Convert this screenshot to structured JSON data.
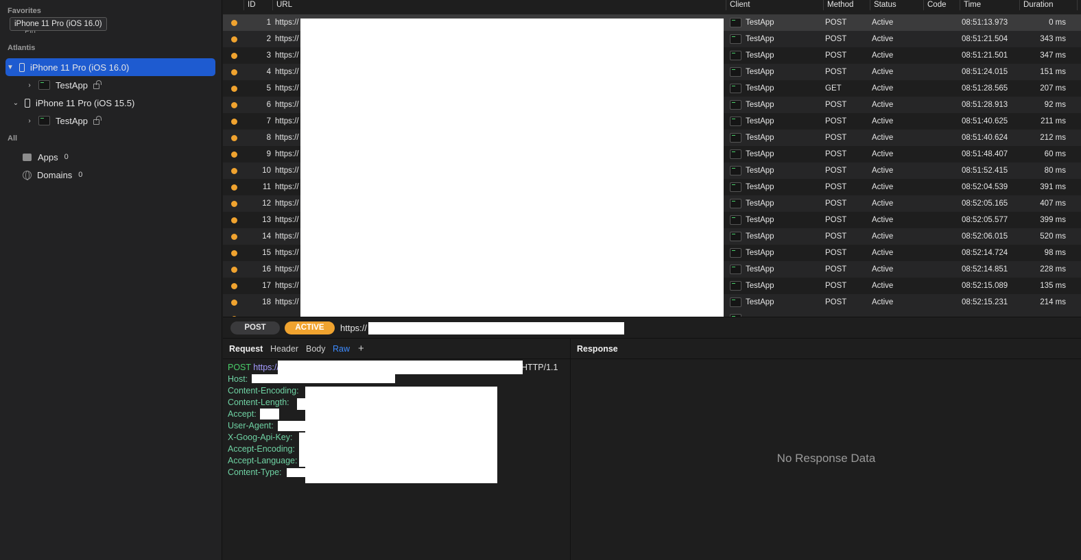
{
  "sidebar": {
    "favorites_title": "Favorites",
    "tooltip": "iPhone 11 Pro (iOS 16.0)",
    "pin_label": "Pin",
    "atlantis_title": "Atlantis",
    "devices": [
      {
        "label": "iPhone 11 Pro (iOS 16.0)",
        "app": "TestApp"
      },
      {
        "label": "iPhone 11 Pro (iOS 15.5)",
        "app": "TestApp"
      }
    ],
    "all_title": "All",
    "apps_label": "Apps",
    "apps_count": "0",
    "domains_label": "Domains",
    "domains_count": "0"
  },
  "table": {
    "headers": {
      "id": "ID",
      "url": "URL",
      "client": "Client",
      "method": "Method",
      "status": "Status",
      "code": "Code",
      "time": "Time",
      "duration": "Duration"
    },
    "rows": [
      {
        "id": "1",
        "url": "https://",
        "client": "TestApp",
        "method": "POST",
        "status": "Active",
        "time": "08:51:13.973",
        "duration": "0 ms"
      },
      {
        "id": "2",
        "url": "https://",
        "client": "TestApp",
        "method": "POST",
        "status": "Active",
        "time": "08:51:21.504",
        "duration": "343 ms"
      },
      {
        "id": "3",
        "url": "https://",
        "client": "TestApp",
        "method": "POST",
        "status": "Active",
        "time": "08:51:21.501",
        "duration": "347 ms"
      },
      {
        "id": "4",
        "url": "https://",
        "client": "TestApp",
        "method": "POST",
        "status": "Active",
        "time": "08:51:24.015",
        "duration": "151 ms"
      },
      {
        "id": "5",
        "url": "https://",
        "client": "TestApp",
        "method": "GET",
        "status": "Active",
        "time": "08:51:28.565",
        "duration": "207 ms"
      },
      {
        "id": "6",
        "url": "https://",
        "client": "TestApp",
        "method": "POST",
        "status": "Active",
        "time": "08:51:28.913",
        "duration": "92 ms"
      },
      {
        "id": "7",
        "url": "https://",
        "client": "TestApp",
        "method": "POST",
        "status": "Active",
        "time": "08:51:40.625",
        "duration": "211 ms"
      },
      {
        "id": "8",
        "url": "https://",
        "client": "TestApp",
        "method": "POST",
        "status": "Active",
        "time": "08:51:40.624",
        "duration": "212 ms"
      },
      {
        "id": "9",
        "url": "https://",
        "client": "TestApp",
        "method": "POST",
        "status": "Active",
        "time": "08:51:48.407",
        "duration": "60 ms"
      },
      {
        "id": "10",
        "url": "https://",
        "client": "TestApp",
        "method": "POST",
        "status": "Active",
        "time": "08:51:52.415",
        "duration": "80 ms"
      },
      {
        "id": "11",
        "url": "https://",
        "client": "TestApp",
        "method": "POST",
        "status": "Active",
        "time": "08:52:04.539",
        "duration": "391 ms"
      },
      {
        "id": "12",
        "url": "https://",
        "client": "TestApp",
        "method": "POST",
        "status": "Active",
        "time": "08:52:05.165",
        "duration": "407 ms"
      },
      {
        "id": "13",
        "url": "https://",
        "client": "TestApp",
        "method": "POST",
        "status": "Active",
        "time": "08:52:05.577",
        "duration": "399 ms"
      },
      {
        "id": "14",
        "url": "https://",
        "client": "TestApp",
        "method": "POST",
        "status": "Active",
        "time": "08:52:06.015",
        "duration": "520 ms"
      },
      {
        "id": "15",
        "url": "https://",
        "client": "TestApp",
        "method": "POST",
        "status": "Active",
        "time": "08:52:14.724",
        "duration": "98 ms"
      },
      {
        "id": "16",
        "url": "https://",
        "client": "TestApp",
        "method": "POST",
        "status": "Active",
        "time": "08:52:14.851",
        "duration": "228 ms"
      },
      {
        "id": "17",
        "url": "https://",
        "client": "TestApp",
        "method": "POST",
        "status": "Active",
        "time": "08:52:15.089",
        "duration": "135 ms"
      },
      {
        "id": "18",
        "url": "https://",
        "client": "TestApp",
        "method": "POST",
        "status": "Active",
        "time": "08:52:15.231",
        "duration": "214 ms"
      }
    ],
    "status_dot_color": "#f0a32f"
  },
  "request_bar": {
    "method": "POST",
    "status": "ACTIVE",
    "url": "https://"
  },
  "request_panel": {
    "title": "Request",
    "tabs": [
      "Header",
      "Body",
      "Raw"
    ],
    "add_tab": "+",
    "raw": {
      "method": "POST",
      "url": "https://",
      "protocol": "HTTP/1.1",
      "headers": [
        "Host:",
        "Content-Encoding:",
        "Content-Length:",
        "Accept:",
        "User-Agent:",
        "X-Goog-Api-Key:",
        "Accept-Encoding:",
        "Accept-Language:",
        "Content-Type:"
      ]
    }
  },
  "response_panel": {
    "title": "Response",
    "empty_text": "No Response Data"
  },
  "colors": {
    "accent_selection": "#1e5bd0",
    "active_orange": "#f0a32f",
    "raw_tab_blue": "#3d8bff",
    "header_key_green": "#6fd3a4"
  }
}
